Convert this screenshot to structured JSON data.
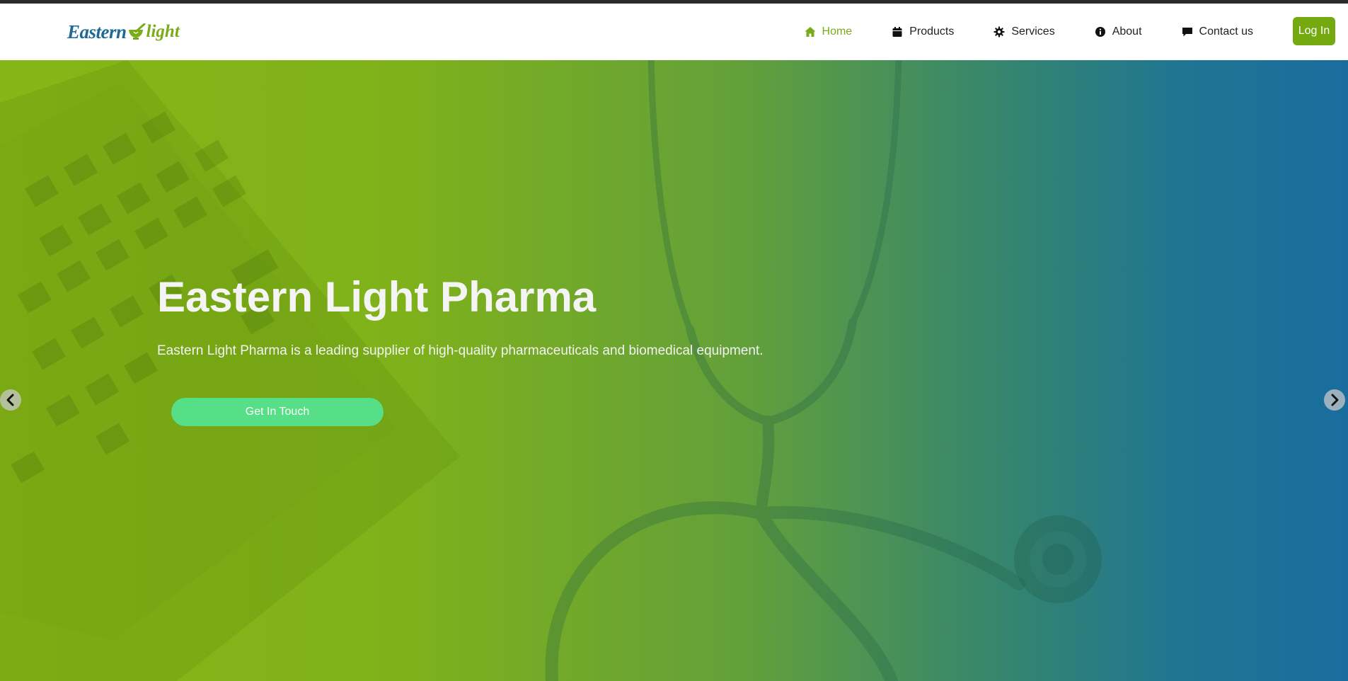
{
  "brand": {
    "logo_word1": "Eastern",
    "logo_word2": "light",
    "logo_color_primary": "#1e6a97",
    "logo_color_accent": "#7aab1a"
  },
  "nav": {
    "items": [
      {
        "label": "Home",
        "icon": "home-icon",
        "active": true
      },
      {
        "label": "Products",
        "icon": "calendar-icon",
        "active": false
      },
      {
        "label": "Services",
        "icon": "gear-icon",
        "active": false
      },
      {
        "label": "About",
        "icon": "info-icon",
        "active": false
      },
      {
        "label": "Contact us",
        "icon": "chat-icon",
        "active": false
      }
    ],
    "login_label": "Log In",
    "accent_color": "#74aa10"
  },
  "hero": {
    "title": "Eastern Light Pharma",
    "subtitle": "Eastern Light Pharma is a leading supplier of high-quality pharmaceuticals and biomedical equipment.",
    "cta_label": "Get In Touch",
    "cta_color": "#56df86",
    "gradient_start": "#86b616",
    "gradient_end": "#196d9e"
  },
  "carousel": {
    "prev_icon": "chevron-left-icon",
    "next_icon": "chevron-right-icon"
  }
}
